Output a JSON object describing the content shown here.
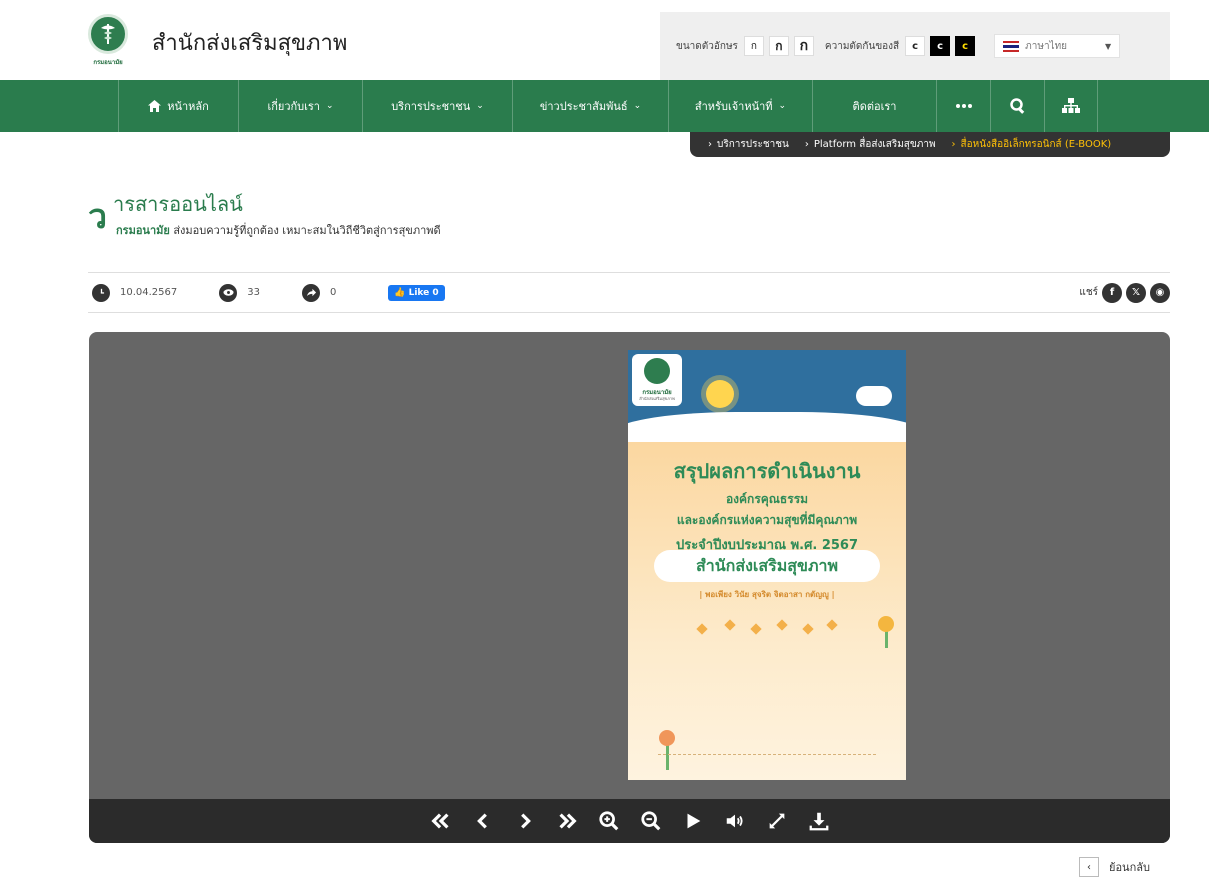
{
  "header": {
    "site_title": "สำนักส่งเสริมสุขภาพ",
    "logo_caption": "กรมอนามัย",
    "font_size_label": "ขนาดตัวอักษร",
    "font_sizes": [
      "ก",
      "ก",
      "ก"
    ],
    "contrast_label": "ความตัดกันของสี",
    "contrast_options": [
      "c",
      "c",
      "c"
    ],
    "language": "ภาษาไทย"
  },
  "nav": {
    "items": [
      {
        "label": "หน้าหลัก",
        "icon": "home-icon",
        "dropdown": false
      },
      {
        "label": "เกี่ยวกับเรา",
        "dropdown": true
      },
      {
        "label": "บริการประชาชน",
        "dropdown": true
      },
      {
        "label": "ข่าวประชาสัมพันธ์",
        "dropdown": true
      },
      {
        "label": "สำหรับเจ้าหน้าที่",
        "dropdown": true
      },
      {
        "label": "ติดต่อเรา",
        "dropdown": false
      }
    ],
    "more_icon": "ellipsis-icon",
    "search_icon": "search-icon",
    "sitemap_icon": "sitemap-icon"
  },
  "breadcrumb": {
    "items": [
      "บริการประชาชน",
      "Platform สื่อส่งเสริมสุขภาพ"
    ],
    "current": "สื่อหนังสืออิเล็กทรอนิกส์ (E-BOOK)"
  },
  "page": {
    "title": "ารสารออนไลน์",
    "initial": "ว",
    "subtitle_bold": "กรมอนามัย",
    "subtitle": " ส่งมอบความรู้ที่ถูกต้อง เหมาะสมในวิถีชีวิตสู่การสุขภาพดี"
  },
  "meta": {
    "date": "10.04.2567",
    "views": "33",
    "shares": "0",
    "fb_like": "Like 0",
    "share_label": "แชร์"
  },
  "ebook": {
    "cover_logo_text": "กรมอนามัย",
    "cover_logo_sub": "สำนักส่งเสริมสุขภาพ",
    "title_line1": "สรุปผลการดำเนินงาน",
    "title_line2": "องค์กรคุณธรรม",
    "title_line3": "และองค์กรแห่งความสุขที่มีคุณภาพ",
    "title_line4": "ประจำปีงบประมาณ พ.ศ. 2567",
    "department": "สำนักส่งเสริมสุขภาพ",
    "motto": "| พอเพียง วินัย สุจริต จิตอาสา กตัญญู |"
  },
  "viewer_controls": [
    "first-page-icon",
    "prev-page-icon",
    "next-page-icon",
    "last-page-icon",
    "zoom-in-icon",
    "zoom-out-icon",
    "play-icon",
    "sound-icon",
    "fullscreen-icon",
    "download-icon"
  ],
  "footer": {
    "back_label": "ย้อนกลับ"
  },
  "colors": {
    "brand_green": "#2a7c4d",
    "breadcrumb_bg": "#333333",
    "breadcrumb_current": "#ffc107",
    "viewer_bg": "#666666",
    "fb_blue": "#1877f2"
  }
}
